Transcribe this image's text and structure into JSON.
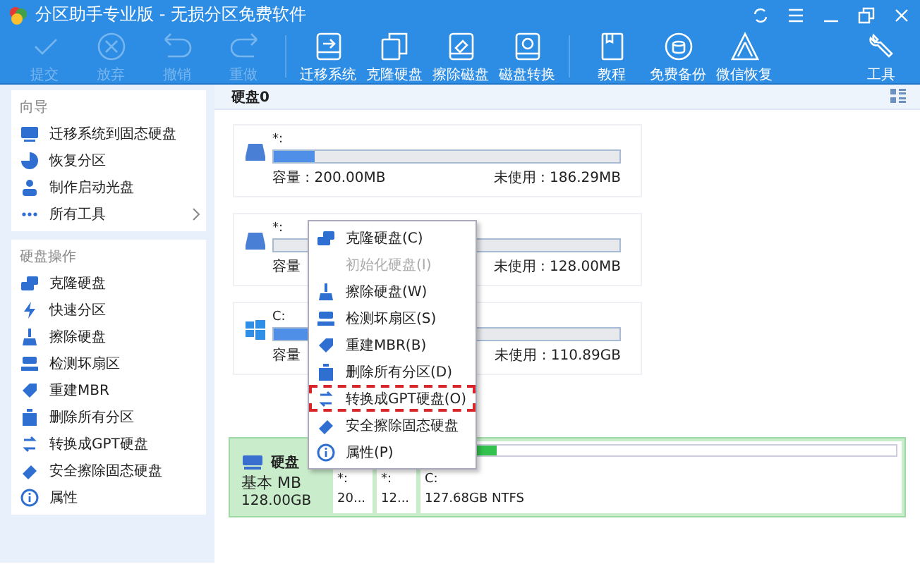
{
  "window": {
    "title": "分区助手专业版 - 无损分区免费软件"
  },
  "toolbar": [
    {
      "label": "提交",
      "disabled": true
    },
    {
      "label": "放弃",
      "disabled": true
    },
    {
      "label": "撤销",
      "disabled": true
    },
    {
      "label": "重做",
      "disabled": true
    },
    {
      "label": "迁移系统",
      "disabled": false
    },
    {
      "label": "克隆硬盘",
      "disabled": false
    },
    {
      "label": "擦除磁盘",
      "disabled": false
    },
    {
      "label": "磁盘转换",
      "disabled": false
    },
    {
      "label": "教程",
      "disabled": false
    },
    {
      "label": "免费备份",
      "disabled": false
    },
    {
      "label": "微信恢复",
      "disabled": false
    },
    {
      "label": "工具",
      "disabled": false
    }
  ],
  "sidebar": [
    {
      "title": "向导",
      "items": [
        {
          "label": "迁移系统到固态硬盘"
        },
        {
          "label": "恢复分区"
        },
        {
          "label": "制作启动光盘"
        },
        {
          "label": "所有工具",
          "submenu": true
        }
      ]
    },
    {
      "title": "硬盘操作",
      "items": [
        {
          "label": "克隆硬盘"
        },
        {
          "label": "快速分区"
        },
        {
          "label": "擦除硬盘"
        },
        {
          "label": "检测坏扇区"
        },
        {
          "label": "重建MBR"
        },
        {
          "label": "删除所有分区"
        },
        {
          "label": "转换成GPT硬盘"
        },
        {
          "label": "安全擦除固态硬盘"
        },
        {
          "label": "属性"
        }
      ]
    }
  ],
  "disk_header": "硬盘0",
  "partitions": [
    {
      "name": "*:",
      "level": 0.12,
      "capacity": "容量 : 200.00MB",
      "free": "未使用 : 186.29MB"
    },
    {
      "name": "*:",
      "level": 0,
      "capacity": "容量",
      "free": "未使用 : 128.00MB"
    },
    {
      "name": "C:",
      "level": 0.13,
      "capacity": "容量",
      "free": "未使用 : 110.89GB"
    }
  ],
  "disk_map": {
    "selected": true,
    "name": "硬盘",
    "type": "基本 MB",
    "size": "128.00GB",
    "partitions": [
      {
        "name": "*:",
        "size": "20..."
      },
      {
        "name": "*:",
        "size": "12..."
      },
      {
        "name": "C:",
        "size": "127.68GB NTFS",
        "level": 0.15
      }
    ]
  },
  "context_menu": [
    {
      "label": "克隆硬盘(C)",
      "disabled": false,
      "selected": false
    },
    {
      "label": "初始化硬盘(I)",
      "disabled": true,
      "selected": false
    },
    {
      "label": "擦除硬盘(W)",
      "disabled": false,
      "selected": false
    },
    {
      "label": "检测坏扇区(S)",
      "disabled": false,
      "selected": false
    },
    {
      "label": "重建MBR(B)",
      "disabled": false,
      "selected": false
    },
    {
      "label": "删除所有分区(D)",
      "disabled": false,
      "selected": false
    },
    {
      "label": "转换成GPT硬盘(O)",
      "disabled": false,
      "selected": true
    },
    {
      "label": "安全擦除固态硬盘",
      "disabled": false,
      "selected": false
    },
    {
      "label": "属性(P)",
      "disabled": false,
      "selected": false
    }
  ]
}
